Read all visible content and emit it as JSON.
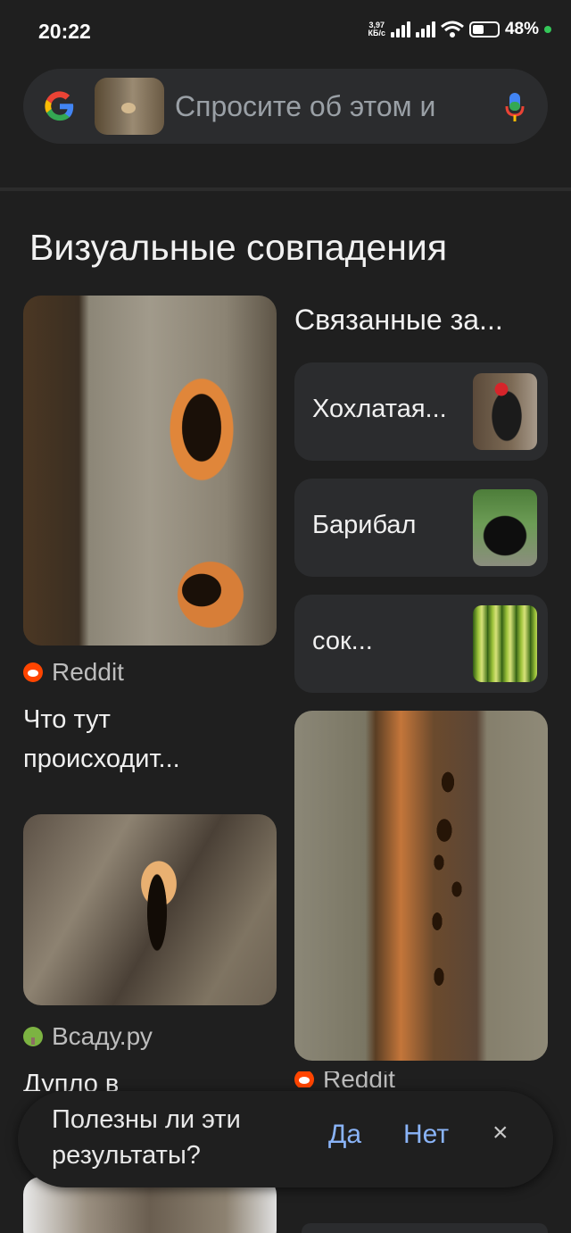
{
  "status_bar": {
    "time": "20:22",
    "net_speed_value": "3,97",
    "net_speed_unit": "КБ/с",
    "battery": "48%"
  },
  "search": {
    "placeholder": "Спросите об этом и",
    "logo": "google-g-icon",
    "mic_icon": "mic-icon"
  },
  "section_title": "Визуальные совпадения",
  "results_left": [
    {
      "source": "Reddit",
      "source_icon": "reddit-icon",
      "title": "Что тут происходит..."
    },
    {
      "source": "Всаду.ру",
      "source_icon": "tree-icon",
      "title": "Дупло в"
    }
  ],
  "related": {
    "title": "Связанные за...",
    "items": [
      {
        "label": "Хохлатая..."
      },
      {
        "label": "Барибал"
      },
      {
        "label": "сок..."
      }
    ]
  },
  "results_right": [
    {
      "source": "Reddit",
      "source_icon": "reddit-icon"
    }
  ],
  "feedback": {
    "question": "Полезны ли эти результаты?",
    "yes": "Да",
    "no": "Нет",
    "close": "×"
  },
  "colors": {
    "background": "#1f1f1f",
    "card": "#2b2c2e",
    "link": "#8ab4f8"
  }
}
